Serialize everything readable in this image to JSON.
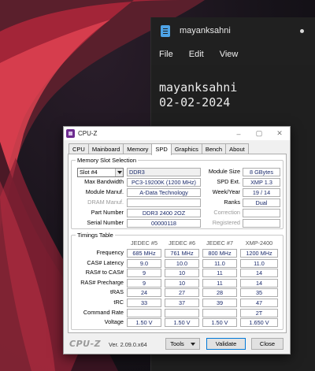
{
  "notepad": {
    "tab_title": "mayanksahni",
    "menu": [
      "File",
      "Edit",
      "View"
    ],
    "lines": [
      "mayanksahni",
      "02-02-2024"
    ]
  },
  "cpuz": {
    "title": "CPU-Z",
    "window_controls": [
      "–",
      "▢",
      "✕"
    ],
    "tabs": [
      "CPU",
      "Mainboard",
      "Memory",
      "SPD",
      "Graphics",
      "Bench",
      "About"
    ],
    "active_tab": "SPD",
    "memory_slot": {
      "group_label": "Memory Slot Selection",
      "slot": "Slot #4",
      "type": "DDR3",
      "max_bandwidth_label": "Max Bandwidth",
      "max_bandwidth": "PC3-19200K (1200 MHz)",
      "manuf_label": "Module Manuf.",
      "manuf": "A-Data Technology",
      "dram_manuf_label": "DRAM Manuf.",
      "dram_manuf": "",
      "part_label": "Part Number",
      "part": "DDR3 2400 2OZ",
      "serial_label": "Serial Number",
      "serial": "00000118",
      "size_label": "Module Size",
      "size": "8 GBytes",
      "spd_ext_label": "SPD Ext.",
      "spd_ext": "XMP 1.3",
      "week_label": "Week/Year",
      "week": "19 / 14",
      "ranks_label": "Ranks",
      "ranks": "Dual",
      "correction_label": "Correction",
      "correction": "",
      "registered_label": "Registered",
      "registered": ""
    },
    "timings": {
      "group_label": "Timings Table",
      "columns": [
        "JEDEC #5",
        "JEDEC #6",
        "JEDEC #7",
        "XMP-2400"
      ],
      "rows": [
        {
          "label": "Frequency",
          "values": [
            "685 MHz",
            "761 MHz",
            "800 MHz",
            "1200 MHz"
          ]
        },
        {
          "label": "CAS# Latency",
          "values": [
            "9.0",
            "10.0",
            "11.0",
            "11.0"
          ]
        },
        {
          "label": "RAS# to CAS#",
          "values": [
            "9",
            "10",
            "11",
            "14"
          ]
        },
        {
          "label": "RAS# Precharge",
          "values": [
            "9",
            "10",
            "11",
            "14"
          ]
        },
        {
          "label": "tRAS",
          "values": [
            "24",
            "27",
            "28",
            "35"
          ]
        },
        {
          "label": "tRC",
          "values": [
            "33",
            "37",
            "39",
            "47"
          ]
        },
        {
          "label": "Command Rate",
          "values": [
            "",
            "",
            "",
            "2T"
          ]
        },
        {
          "label": "Voltage",
          "values": [
            "1.50 V",
            "1.50 V",
            "1.50 V",
            "1.650 V"
          ]
        }
      ]
    },
    "footer": {
      "logo": "CPU-Z",
      "version": "Ver. 2.09.0.x64",
      "tools": "Tools",
      "validate": "Validate",
      "close": "Close"
    }
  }
}
